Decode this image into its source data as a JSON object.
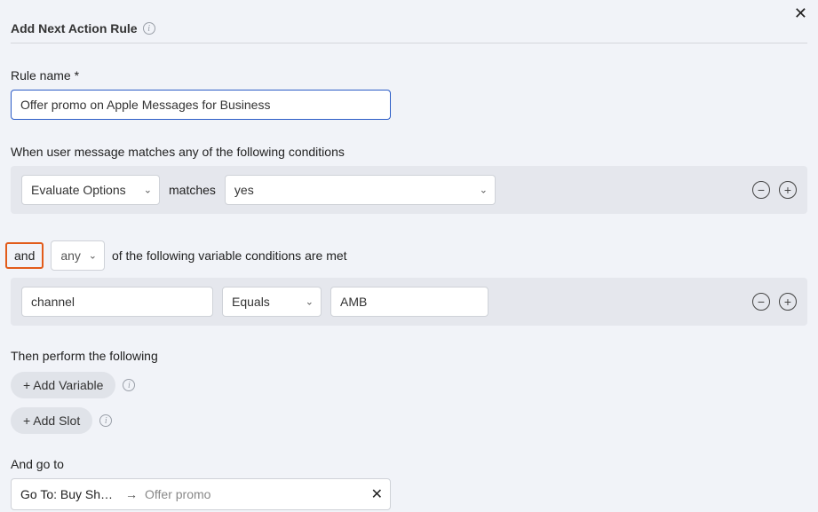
{
  "header": {
    "title": "Add Next Action Rule"
  },
  "rule_name": {
    "label": "Rule name *",
    "value": "Offer promo on Apple Messages for Business"
  },
  "message_conditions": {
    "label": "When user message matches any of the following conditions",
    "field_select": "Evaluate Options",
    "relation": "matches",
    "value": "yes"
  },
  "logic": {
    "and": "and",
    "any": "any",
    "suffix": "of the following variable conditions are met"
  },
  "variable_conditions": {
    "variable": "channel",
    "operator": "Equals",
    "value": "AMB"
  },
  "then": {
    "label": "Then perform the following",
    "add_variable": "+ Add Variable",
    "add_slot": "+ Add Slot"
  },
  "goto": {
    "label": "And go to",
    "prefix": "Go To: Buy Sho…",
    "value": "Offer promo"
  },
  "icons": {
    "minus": "−",
    "plus": "+",
    "info": "i",
    "close": "✕",
    "chevron": "⌄",
    "arrow": "→"
  }
}
